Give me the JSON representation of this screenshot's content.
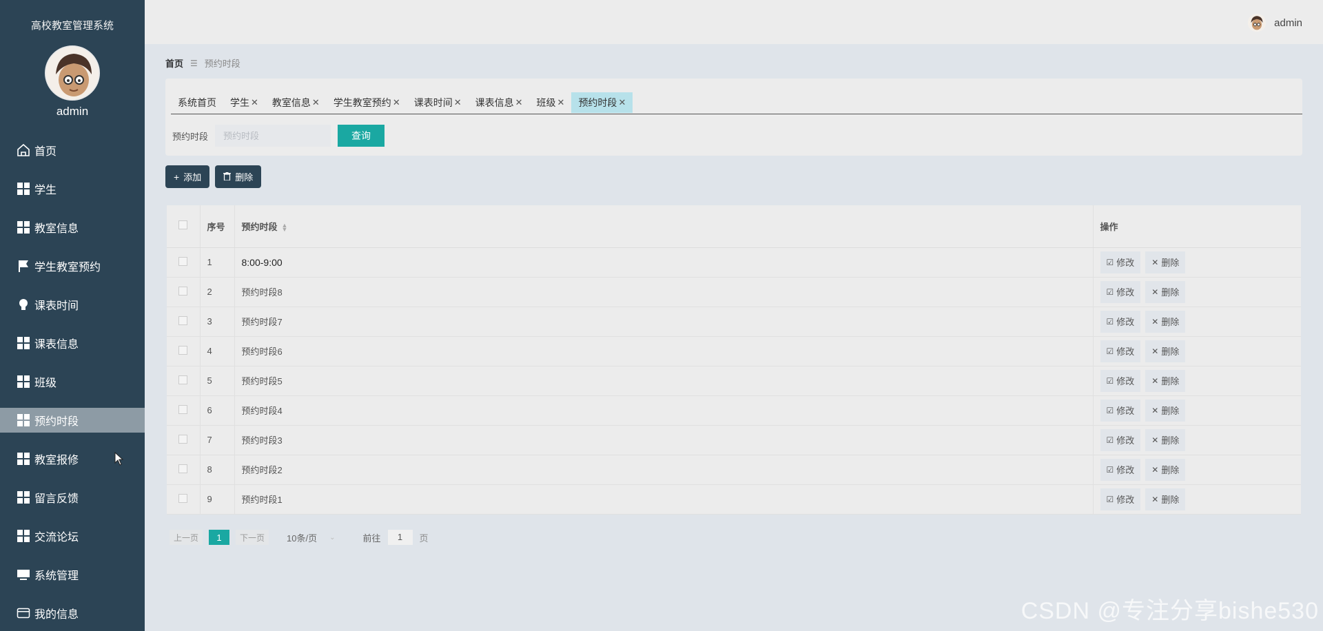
{
  "sidebar": {
    "title": "高校教室管理系统",
    "username": "admin",
    "items": [
      {
        "label": "首页",
        "icon": "home-icon"
      },
      {
        "label": "学生",
        "icon": "grid-icon"
      },
      {
        "label": "教室信息",
        "icon": "grid-icon"
      },
      {
        "label": "学生教室预约",
        "icon": "flag-icon"
      },
      {
        "label": "课表时间",
        "icon": "bulb-icon"
      },
      {
        "label": "课表信息",
        "icon": "grid-icon"
      },
      {
        "label": "班级",
        "icon": "grid-icon"
      },
      {
        "label": "预约时段",
        "icon": "grid-icon",
        "active": true
      },
      {
        "label": "教室报修",
        "icon": "grid-icon"
      },
      {
        "label": "留言反馈",
        "icon": "grid-icon"
      },
      {
        "label": "交流论坛",
        "icon": "grid-icon"
      },
      {
        "label": "系统管理",
        "icon": "monitor-icon"
      },
      {
        "label": "我的信息",
        "icon": "card-icon"
      }
    ]
  },
  "header": {
    "username": "admin"
  },
  "breadcrumb": {
    "home": "首页",
    "separator": "☰",
    "current": "预约时段"
  },
  "tabs": [
    {
      "label": "系统首页",
      "closable": false
    },
    {
      "label": "学生",
      "closable": true
    },
    {
      "label": "教室信息",
      "closable": true
    },
    {
      "label": "学生教室预约",
      "closable": true
    },
    {
      "label": "课表时间",
      "closable": true
    },
    {
      "label": "课表信息",
      "closable": true
    },
    {
      "label": "班级",
      "closable": true
    },
    {
      "label": "预约时段",
      "closable": true,
      "active": true
    }
  ],
  "search": {
    "label": "预约时段",
    "placeholder": "预约时段",
    "button": "查询"
  },
  "actions": {
    "add": "添加",
    "delete": "删除"
  },
  "table": {
    "headers": {
      "index": "序号",
      "name": "预约时段",
      "ops": "操作"
    },
    "edit_label": "修改",
    "delete_label": "删除",
    "rows": [
      {
        "index": "1",
        "name": "8:00-9:00"
      },
      {
        "index": "2",
        "name": "预约时段8"
      },
      {
        "index": "3",
        "name": "预约时段7"
      },
      {
        "index": "4",
        "name": "预约时段6"
      },
      {
        "index": "5",
        "name": "预约时段5"
      },
      {
        "index": "6",
        "name": "预约时段4"
      },
      {
        "index": "7",
        "name": "预约时段3"
      },
      {
        "index": "8",
        "name": "预约时段2"
      },
      {
        "index": "9",
        "name": "预约时段1"
      }
    ]
  },
  "pagination": {
    "prev": "上一页",
    "current": "1",
    "next": "下一页",
    "page_size": "10条/页",
    "goto_prefix": "前往",
    "goto_value": "1",
    "goto_suffix": "页"
  },
  "watermark": "CSDN @专注分享bishe530",
  "colors": {
    "sidebar_bg": "#2c4455",
    "accent": "#1aa8a2",
    "active_tab": "#b7e1ea"
  }
}
